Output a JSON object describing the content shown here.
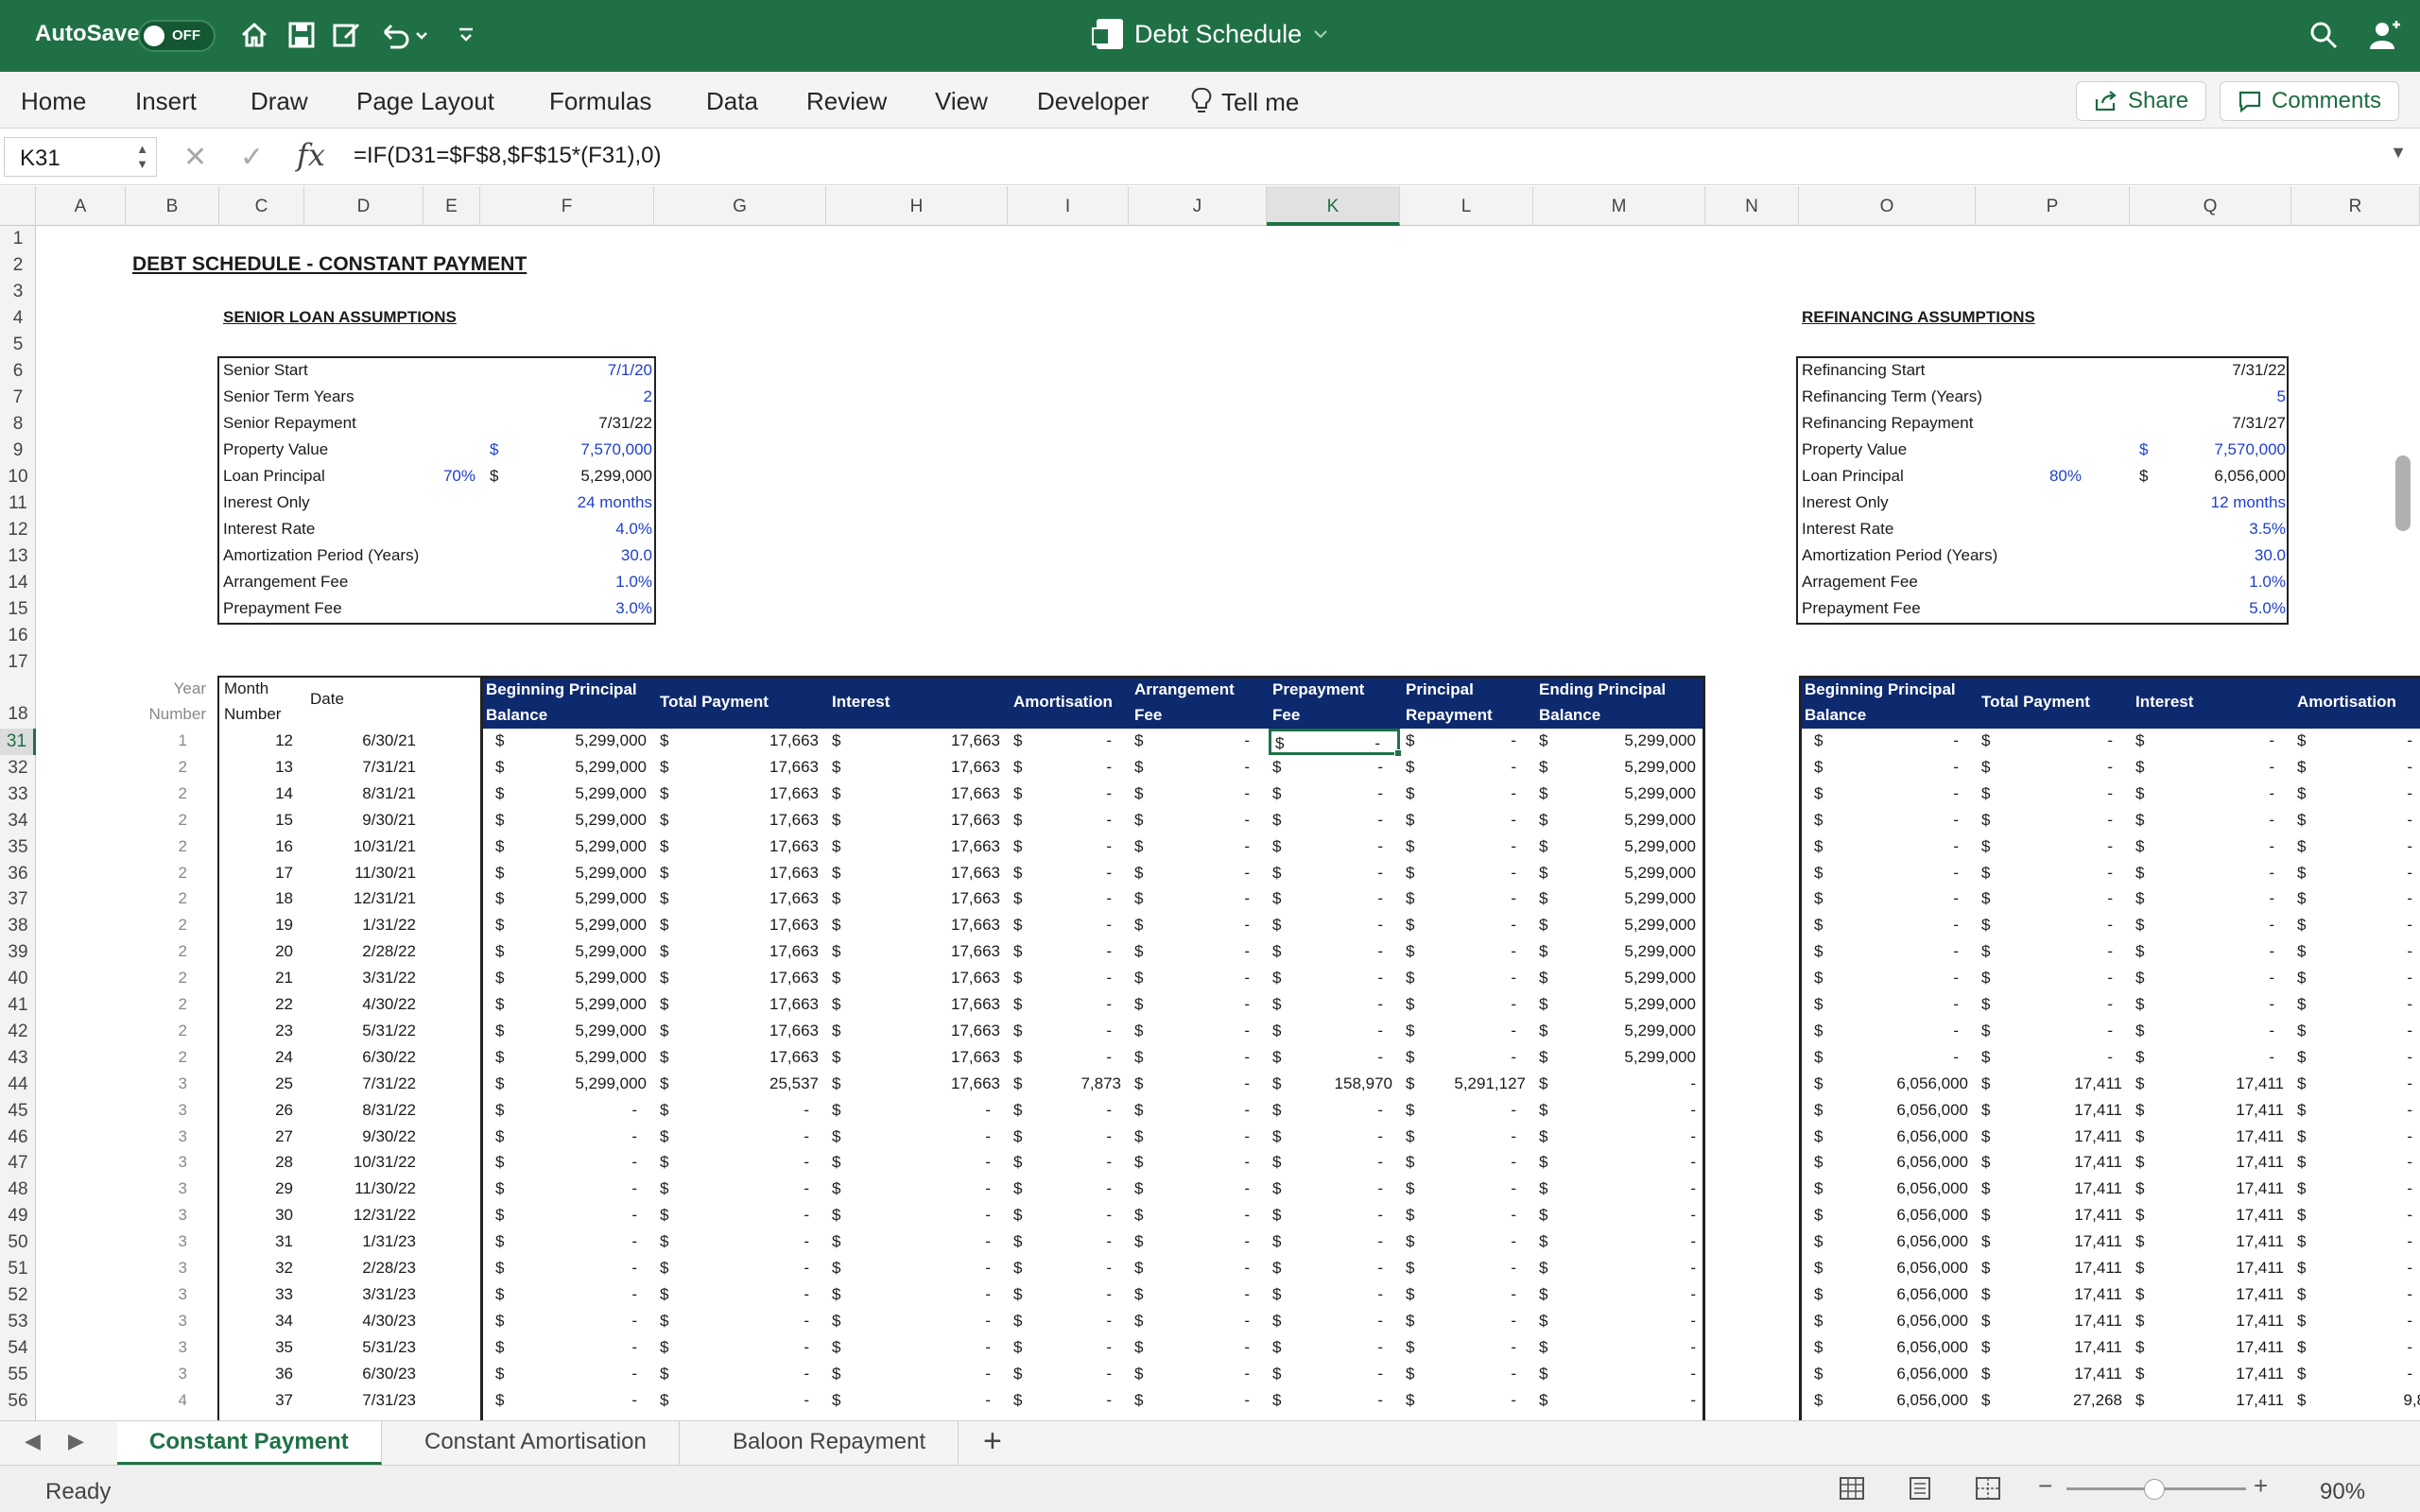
{
  "window": {
    "autosave": "AutoSave",
    "autosave_state": "OFF",
    "title": "Debt Schedule"
  },
  "ribbon": {
    "tabs": [
      "Home",
      "Insert",
      "Draw",
      "Page Layout",
      "Formulas",
      "Data",
      "Review",
      "View",
      "Developer"
    ],
    "tell_me": "Tell me",
    "share": "Share",
    "comments": "Comments"
  },
  "formula_bar": {
    "cell_ref": "K31",
    "formula": "=IF(D31=$F$8,$F$15*(F31),0)"
  },
  "columns": [
    "A",
    "B",
    "C",
    "D",
    "E",
    "F",
    "G",
    "H",
    "I",
    "J",
    "K",
    "L",
    "M",
    "N",
    "O",
    "P",
    "Q",
    "R"
  ],
  "selected_column": "K",
  "selected_row": "31",
  "row_numbers": [
    "1",
    "2",
    "3",
    "4",
    "5",
    "6",
    "7",
    "8",
    "9",
    "10",
    "11",
    "12",
    "13",
    "14",
    "15",
    "16",
    "17",
    "18",
    "31",
    "32",
    "33",
    "34",
    "35",
    "36",
    "37",
    "38",
    "39",
    "40",
    "41",
    "42",
    "43",
    "44",
    "45",
    "46",
    "47",
    "48",
    "49",
    "50",
    "51",
    "52",
    "53",
    "54",
    "55",
    "56"
  ],
  "sheet": {
    "title": "DEBT SCHEDULE - CONSTANT PAYMENT",
    "senior": {
      "heading": "SENIOR LOAN ASSUMPTIONS",
      "rows": [
        {
          "label": "Senior Start",
          "pct": "",
          "cur": "",
          "value": "7/1/20",
          "blue": true
        },
        {
          "label": "Senior Term Years",
          "pct": "",
          "cur": "",
          "value": "2",
          "blue": true
        },
        {
          "label": "Senior Repayment",
          "pct": "",
          "cur": "",
          "value": "7/31/22",
          "blue": false
        },
        {
          "label": "Property Value",
          "pct": "",
          "cur": "$",
          "value": "7,570,000",
          "blue": true
        },
        {
          "label": "Loan Principal",
          "pct": "70%",
          "cur": "$",
          "value": "5,299,000",
          "blue": false
        },
        {
          "label": "Inerest Only",
          "pct": "",
          "cur": "",
          "value": "24 months",
          "blue": true
        },
        {
          "label": "Interest Rate",
          "pct": "",
          "cur": "",
          "value": "4.0%",
          "blue": true
        },
        {
          "label": "Amortization Period (Years)",
          "pct": "",
          "cur": "",
          "value": "30.0",
          "blue": true
        },
        {
          "label": "Arrangement Fee",
          "pct": "",
          "cur": "",
          "value": "1.0%",
          "blue": true
        },
        {
          "label": "Prepayment Fee",
          "pct": "",
          "cur": "",
          "value": "3.0%",
          "blue": true
        }
      ]
    },
    "refi": {
      "heading": "REFINANCING ASSUMPTIONS",
      "rows": [
        {
          "label": "Refinancing Start",
          "pct": "",
          "cur": "",
          "value": "7/31/22",
          "blue": false
        },
        {
          "label": "Refinancing Term (Years)",
          "pct": "",
          "cur": "",
          "value": "5",
          "blue": true
        },
        {
          "label": "Refinancing Repayment",
          "pct": "",
          "cur": "",
          "value": "7/31/27",
          "blue": false
        },
        {
          "label": "Property Value",
          "pct": "",
          "cur": "$",
          "value": "7,570,000",
          "blue": true
        },
        {
          "label": "Loan Principal",
          "pct": "80%",
          "cur": "$",
          "value": "6,056,000",
          "blue": false
        },
        {
          "label": "Inerest Only",
          "pct": "",
          "cur": "",
          "value": "12 months",
          "blue": true
        },
        {
          "label": "Interest Rate",
          "pct": "",
          "cur": "",
          "value": "3.5%",
          "blue": true
        },
        {
          "label": "Amortization Period (Years)",
          "pct": "",
          "cur": "",
          "value": "30.0",
          "blue": true
        },
        {
          "label": "Arragement Fee",
          "pct": "",
          "cur": "",
          "value": "1.0%",
          "blue": true
        },
        {
          "label": "Prepayment Fee",
          "pct": "",
          "cur": "",
          "value": "5.0%",
          "blue": true
        }
      ]
    },
    "table_headers": {
      "year": [
        "Year",
        "Number"
      ],
      "month": [
        "Month",
        "Number"
      ],
      "date": "Date",
      "senior": [
        [
          "Beginning Principal",
          "Balance"
        ],
        [
          "Total Payment"
        ],
        [
          "Interest"
        ],
        [
          "Amortisation"
        ],
        [
          "Arrangement",
          "Fee"
        ],
        [
          "Prepayment",
          "Fee"
        ],
        [
          "Principal",
          "Repayment"
        ],
        [
          "Ending Principal",
          "Balance"
        ]
      ],
      "refi": [
        [
          "Beginning Principal",
          "Balance"
        ],
        [
          "Total Payment"
        ],
        [
          "Interest"
        ],
        [
          "Amortisation"
        ]
      ]
    },
    "rows": [
      {
        "y": "1",
        "m": "12",
        "d": "6/30/21",
        "s": [
          "5,299,000",
          "17,663",
          "17,663",
          "-",
          "-",
          "-",
          "-",
          "5,299,000"
        ],
        "r": [
          "-",
          "-",
          "-"
        ]
      },
      {
        "y": "2",
        "m": "13",
        "d": "7/31/21",
        "s": [
          "5,299,000",
          "17,663",
          "17,663",
          "-",
          "-",
          "-",
          "-",
          "5,299,000"
        ],
        "r": [
          "-",
          "-",
          "-"
        ]
      },
      {
        "y": "2",
        "m": "14",
        "d": "8/31/21",
        "s": [
          "5,299,000",
          "17,663",
          "17,663",
          "-",
          "-",
          "-",
          "-",
          "5,299,000"
        ],
        "r": [
          "-",
          "-",
          "-"
        ]
      },
      {
        "y": "2",
        "m": "15",
        "d": "9/30/21",
        "s": [
          "5,299,000",
          "17,663",
          "17,663",
          "-",
          "-",
          "-",
          "-",
          "5,299,000"
        ],
        "r": [
          "-",
          "-",
          "-"
        ]
      },
      {
        "y": "2",
        "m": "16",
        "d": "10/31/21",
        "s": [
          "5,299,000",
          "17,663",
          "17,663",
          "-",
          "-",
          "-",
          "-",
          "5,299,000"
        ],
        "r": [
          "-",
          "-",
          "-"
        ]
      },
      {
        "y": "2",
        "m": "17",
        "d": "11/30/21",
        "s": [
          "5,299,000",
          "17,663",
          "17,663",
          "-",
          "-",
          "-",
          "-",
          "5,299,000"
        ],
        "r": [
          "-",
          "-",
          "-"
        ]
      },
      {
        "y": "2",
        "m": "18",
        "d": "12/31/21",
        "s": [
          "5,299,000",
          "17,663",
          "17,663",
          "-",
          "-",
          "-",
          "-",
          "5,299,000"
        ],
        "r": [
          "-",
          "-",
          "-"
        ]
      },
      {
        "y": "2",
        "m": "19",
        "d": "1/31/22",
        "s": [
          "5,299,000",
          "17,663",
          "17,663",
          "-",
          "-",
          "-",
          "-",
          "5,299,000"
        ],
        "r": [
          "-",
          "-",
          "-"
        ]
      },
      {
        "y": "2",
        "m": "20",
        "d": "2/28/22",
        "s": [
          "5,299,000",
          "17,663",
          "17,663",
          "-",
          "-",
          "-",
          "-",
          "5,299,000"
        ],
        "r": [
          "-",
          "-",
          "-"
        ]
      },
      {
        "y": "2",
        "m": "21",
        "d": "3/31/22",
        "s": [
          "5,299,000",
          "17,663",
          "17,663",
          "-",
          "-",
          "-",
          "-",
          "5,299,000"
        ],
        "r": [
          "-",
          "-",
          "-"
        ]
      },
      {
        "y": "2",
        "m": "22",
        "d": "4/30/22",
        "s": [
          "5,299,000",
          "17,663",
          "17,663",
          "-",
          "-",
          "-",
          "-",
          "5,299,000"
        ],
        "r": [
          "-",
          "-",
          "-"
        ]
      },
      {
        "y": "2",
        "m": "23",
        "d": "5/31/22",
        "s": [
          "5,299,000",
          "17,663",
          "17,663",
          "-",
          "-",
          "-",
          "-",
          "5,299,000"
        ],
        "r": [
          "-",
          "-",
          "-"
        ]
      },
      {
        "y": "2",
        "m": "24",
        "d": "6/30/22",
        "s": [
          "5,299,000",
          "17,663",
          "17,663",
          "-",
          "-",
          "-",
          "-",
          "5,299,000"
        ],
        "r": [
          "-",
          "-",
          "-"
        ]
      },
      {
        "y": "3",
        "m": "25",
        "d": "7/31/22",
        "s": [
          "5,299,000",
          "25,537",
          "17,663",
          "7,873",
          "-",
          "158,970",
          "5,291,127",
          "-"
        ],
        "r": [
          "6,056,000",
          "17,411",
          "17,411"
        ]
      },
      {
        "y": "3",
        "m": "26",
        "d": "8/31/22",
        "s": [
          "-",
          "-",
          "-",
          "-",
          "-",
          "-",
          "-",
          "-"
        ],
        "r": [
          "6,056,000",
          "17,411",
          "17,411"
        ]
      },
      {
        "y": "3",
        "m": "27",
        "d": "9/30/22",
        "s": [
          "-",
          "-",
          "-",
          "-",
          "-",
          "-",
          "-",
          "-"
        ],
        "r": [
          "6,056,000",
          "17,411",
          "17,411"
        ]
      },
      {
        "y": "3",
        "m": "28",
        "d": "10/31/22",
        "s": [
          "-",
          "-",
          "-",
          "-",
          "-",
          "-",
          "-",
          "-"
        ],
        "r": [
          "6,056,000",
          "17,411",
          "17,411"
        ]
      },
      {
        "y": "3",
        "m": "29",
        "d": "11/30/22",
        "s": [
          "-",
          "-",
          "-",
          "-",
          "-",
          "-",
          "-",
          "-"
        ],
        "r": [
          "6,056,000",
          "17,411",
          "17,411"
        ]
      },
      {
        "y": "3",
        "m": "30",
        "d": "12/31/22",
        "s": [
          "-",
          "-",
          "-",
          "-",
          "-",
          "-",
          "-",
          "-"
        ],
        "r": [
          "6,056,000",
          "17,411",
          "17,411"
        ]
      },
      {
        "y": "3",
        "m": "31",
        "d": "1/31/23",
        "s": [
          "-",
          "-",
          "-",
          "-",
          "-",
          "-",
          "-",
          "-"
        ],
        "r": [
          "6,056,000",
          "17,411",
          "17,411"
        ]
      },
      {
        "y": "3",
        "m": "32",
        "d": "2/28/23",
        "s": [
          "-",
          "-",
          "-",
          "-",
          "-",
          "-",
          "-",
          "-"
        ],
        "r": [
          "6,056,000",
          "17,411",
          "17,411"
        ]
      },
      {
        "y": "3",
        "m": "33",
        "d": "3/31/23",
        "s": [
          "-",
          "-",
          "-",
          "-",
          "-",
          "-",
          "-",
          "-"
        ],
        "r": [
          "6,056,000",
          "17,411",
          "17,411"
        ]
      },
      {
        "y": "3",
        "m": "34",
        "d": "4/30/23",
        "s": [
          "-",
          "-",
          "-",
          "-",
          "-",
          "-",
          "-",
          "-"
        ],
        "r": [
          "6,056,000",
          "17,411",
          "17,411"
        ]
      },
      {
        "y": "3",
        "m": "35",
        "d": "5/31/23",
        "s": [
          "-",
          "-",
          "-",
          "-",
          "-",
          "-",
          "-",
          "-"
        ],
        "r": [
          "6,056,000",
          "17,411",
          "17,411"
        ]
      },
      {
        "y": "3",
        "m": "36",
        "d": "6/30/23",
        "s": [
          "-",
          "-",
          "-",
          "-",
          "-",
          "-",
          "-",
          "-"
        ],
        "r": [
          "6,056,000",
          "17,411",
          "17,411"
        ]
      },
      {
        "y": "4",
        "m": "37",
        "d": "7/31/23",
        "s": [
          "-",
          "-",
          "-",
          "-",
          "-",
          "-",
          "-",
          "-"
        ],
        "r": [
          "6,056,000",
          "27,268",
          "17,411"
        ]
      }
    ],
    "partial_R56": "9,8",
    "currency": "$"
  },
  "sheet_tabs": [
    "Constant Payment",
    "Constant Amortisation",
    "Baloon Repayment"
  ],
  "active_sheet": "Constant Payment",
  "status": {
    "ready": "Ready",
    "zoom": "90%"
  }
}
